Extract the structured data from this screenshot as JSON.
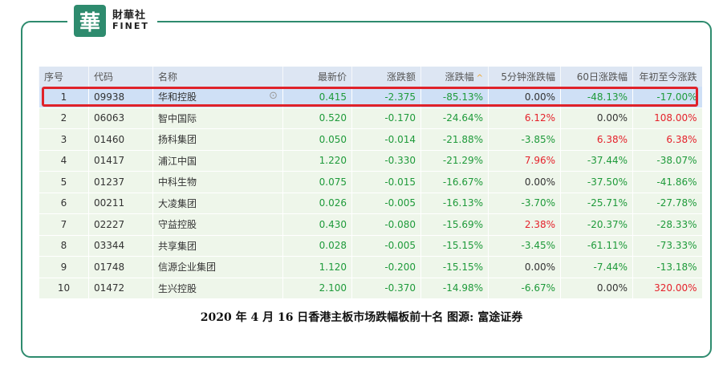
{
  "logo": {
    "mark": "華",
    "name_cn": "財華社",
    "name_en": "FINET"
  },
  "table": {
    "headers": {
      "no": "序号",
      "code": "代码",
      "name": "名称",
      "price": "最新价",
      "change": "涨跌额",
      "change_pct": "涨跌幅",
      "sort_indicator": "^",
      "min5": "5分钟涨跌幅",
      "day60": "60日涨跌幅",
      "ytd": "年初至今涨跌"
    },
    "rows": [
      {
        "no": "1",
        "code": "09938",
        "name": "华和控股",
        "price": "0.415",
        "change": "-2.375",
        "change_pct": "-85.13%",
        "min5": "0.00%",
        "day60": "-48.13%",
        "ytd": "-17.00%"
      },
      {
        "no": "2",
        "code": "06063",
        "name": "智中国际",
        "price": "0.520",
        "change": "-0.170",
        "change_pct": "-24.64%",
        "min5": "6.12%",
        "day60": "0.00%",
        "ytd": "108.00%"
      },
      {
        "no": "3",
        "code": "01460",
        "name": "扬科集团",
        "price": "0.050",
        "change": "-0.014",
        "change_pct": "-21.88%",
        "min5": "-3.85%",
        "day60": "6.38%",
        "ytd": "6.38%"
      },
      {
        "no": "4",
        "code": "01417",
        "name": "浦江中国",
        "price": "1.220",
        "change": "-0.330",
        "change_pct": "-21.29%",
        "min5": "7.96%",
        "day60": "-37.44%",
        "ytd": "-38.07%"
      },
      {
        "no": "5",
        "code": "01237",
        "name": "中科生物",
        "price": "0.075",
        "change": "-0.015",
        "change_pct": "-16.67%",
        "min5": "0.00%",
        "day60": "-37.50%",
        "ytd": "-41.86%"
      },
      {
        "no": "6",
        "code": "00211",
        "name": "大凌集团",
        "price": "0.026",
        "change": "-0.005",
        "change_pct": "-16.13%",
        "min5": "-3.70%",
        "day60": "-25.71%",
        "ytd": "-27.78%"
      },
      {
        "no": "7",
        "code": "02227",
        "name": "守益控股",
        "price": "0.430",
        "change": "-0.080",
        "change_pct": "-15.69%",
        "min5": "2.38%",
        "day60": "-20.37%",
        "ytd": "-28.33%"
      },
      {
        "no": "8",
        "code": "03344",
        "name": "共享集团",
        "price": "0.028",
        "change": "-0.005",
        "change_pct": "-15.15%",
        "min5": "-3.45%",
        "day60": "-61.11%",
        "ytd": "-73.33%"
      },
      {
        "no": "9",
        "code": "01748",
        "name": "信源企业集团",
        "price": "1.120",
        "change": "-0.200",
        "change_pct": "-15.15%",
        "min5": "0.00%",
        "day60": "-7.44%",
        "ytd": "-13.18%"
      },
      {
        "no": "10",
        "code": "01472",
        "name": "生兴控股",
        "price": "2.100",
        "change": "-0.370",
        "change_pct": "-14.98%",
        "min5": "-6.67%",
        "day60": "0.00%",
        "ytd": "320.00%"
      }
    ]
  },
  "caption": "2020 年 4 月 16 日香港主板市场跌幅板前十名  图源: 富途证券",
  "colors": {
    "up": "#e5222b",
    "down": "#1e9a3a",
    "flat": "#333333",
    "brand": "#2e8b6e",
    "highlight": "#e0222a"
  }
}
